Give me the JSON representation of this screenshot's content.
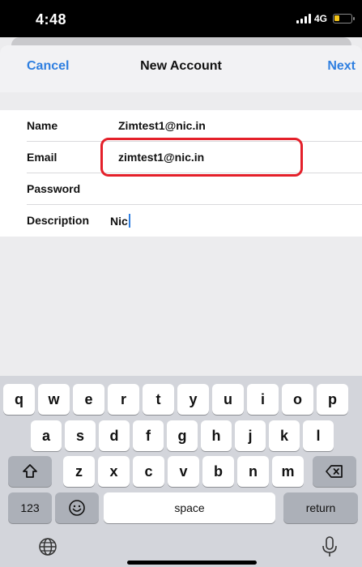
{
  "status_bar": {
    "time": "4:48",
    "network": "4G"
  },
  "nav": {
    "cancel_label": "Cancel",
    "title": "New Account",
    "next_label": "Next"
  },
  "form": {
    "name_label": "Name",
    "name_value": "Zimtest1@nic.in",
    "email_label": "Email",
    "email_value": "zimtest1@nic.in",
    "password_label": "Password",
    "password_value": "",
    "description_label": "Description",
    "description_value": "Nic"
  },
  "keyboard": {
    "row1": [
      "q",
      "w",
      "e",
      "r",
      "t",
      "y",
      "u",
      "i",
      "o",
      "p"
    ],
    "row2": [
      "a",
      "s",
      "d",
      "f",
      "g",
      "h",
      "j",
      "k",
      "l"
    ],
    "row3": [
      "z",
      "x",
      "c",
      "v",
      "b",
      "n",
      "m"
    ],
    "numbers_label": "123",
    "space_label": "space",
    "return_label": "return"
  },
  "icons": [
    "signal-icon",
    "battery-icon",
    "shift-icon",
    "backspace-icon",
    "emoji-icon",
    "globe-icon",
    "microphone-icon"
  ],
  "colors": {
    "accent": "#2f7fe0",
    "highlight": "#e4202a",
    "battery": "#f5c518"
  }
}
